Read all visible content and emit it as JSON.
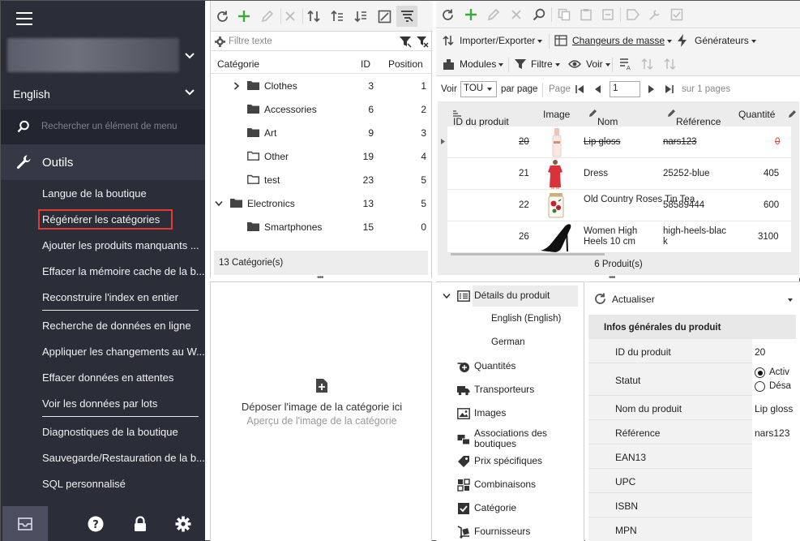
{
  "sidebar": {
    "language": "English",
    "search_placeholder": "Rechercher un élément de menu",
    "section_title": "Outils",
    "items": [
      {
        "label": "Langue de la boutique"
      },
      {
        "label": "Régénérer les catégories"
      },
      {
        "label": "Ajouter les produits manquants ..."
      },
      {
        "label": "Effacer la mémoire cache de la b..."
      },
      {
        "label": "Reconstruire l'index en entier"
      },
      {
        "label": "Recherche de données en ligne"
      },
      {
        "label": "Appliquer les changements au W..."
      },
      {
        "label": "Effacer données en attentes"
      },
      {
        "label": "Voir les données par lots"
      },
      {
        "label": "Diagnostiques de la boutique"
      },
      {
        "label": "Sauvegarde/Restauration de la b..."
      },
      {
        "label": "SQL personnalisé"
      }
    ]
  },
  "categories": {
    "filter_placeholder": "Filtre texte",
    "columns": {
      "name": "Catégorie",
      "id": "ID",
      "position": "Position"
    },
    "rows": [
      {
        "name": "Clothes",
        "id": "3",
        "position": "1"
      },
      {
        "name": "Accessories",
        "id": "6",
        "position": "2"
      },
      {
        "name": "Art",
        "id": "9",
        "position": "3"
      },
      {
        "name": "Other",
        "id": "19",
        "position": "4"
      },
      {
        "name": "test",
        "id": "23",
        "position": "5"
      },
      {
        "name": "Electronics",
        "id": "13",
        "position": "5"
      },
      {
        "name": "Smartphones",
        "id": "15",
        "position": "0"
      }
    ],
    "footer": "13 Catégorie(s)"
  },
  "dropzone": {
    "title": "Déposer l'image de la catégorie ici",
    "subtitle": "Aperçu de l'image de la catégorie"
  },
  "products": {
    "toolbar": {
      "import_export": "Importer/Exporter",
      "mass_changers": "Changeurs de masse",
      "generators": "Générateurs",
      "modules": "Modules",
      "filter": "Filtre",
      "view": "Voir"
    },
    "pager": {
      "show_label": "Voir",
      "per_page_value": "TOU",
      "per_page_label": "par page",
      "page_label": "Page",
      "page_value": "1",
      "of_pages": "sur 1 pages"
    },
    "columns": {
      "id": "ID du produit",
      "image": "Image",
      "name": "Nom",
      "reference": "Référence",
      "quantity": "Quantité"
    },
    "rows": [
      {
        "id": "20",
        "name": "Lip gloss",
        "reference": "nars123",
        "quantity": "0"
      },
      {
        "id": "21",
        "name": "Dress",
        "reference": "25252-blue",
        "quantity": "405"
      },
      {
        "id": "22",
        "name": "Old Country Roses Tin Tea",
        "reference": "58589444",
        "quantity": "600"
      },
      {
        "id": "26",
        "name": "Women High Heels 10 cm",
        "reference": "high-heels-black",
        "quantity": "3100"
      }
    ],
    "footer": "6 Produit(s)"
  },
  "detail_nav": {
    "product_details": "Détails du produit",
    "english": "English (English)",
    "german": "German",
    "quantities": "Quantités",
    "carriers": "Transporteurs",
    "images": "Images",
    "shop_associations": "Associations des boutiques",
    "specific_prices": "Prix spécifiques",
    "combinations": "Combinaisons",
    "category": "Catégorie",
    "suppliers": "Fournisseurs"
  },
  "detail_form": {
    "refresh": "Actualiser",
    "section": "Infos générales du produit",
    "fields": {
      "id_label": "ID du produit",
      "id_value": "20",
      "status_label": "Statut",
      "status_on": "Activ",
      "status_off": "Désa",
      "name_label": "Nom du produit",
      "name_value": "Lip gloss",
      "ref_label": "Référence",
      "ref_value": "nars123",
      "ean_label": "EAN13",
      "upc_label": "UPC",
      "isbn_label": "ISBN",
      "mpn_label": "MPN"
    }
  },
  "colors": {
    "sidebar_bg": "#2b2d38",
    "highlight": "#e53935",
    "add_green": "#3bab3b",
    "out_of_stock": "#e53935"
  }
}
